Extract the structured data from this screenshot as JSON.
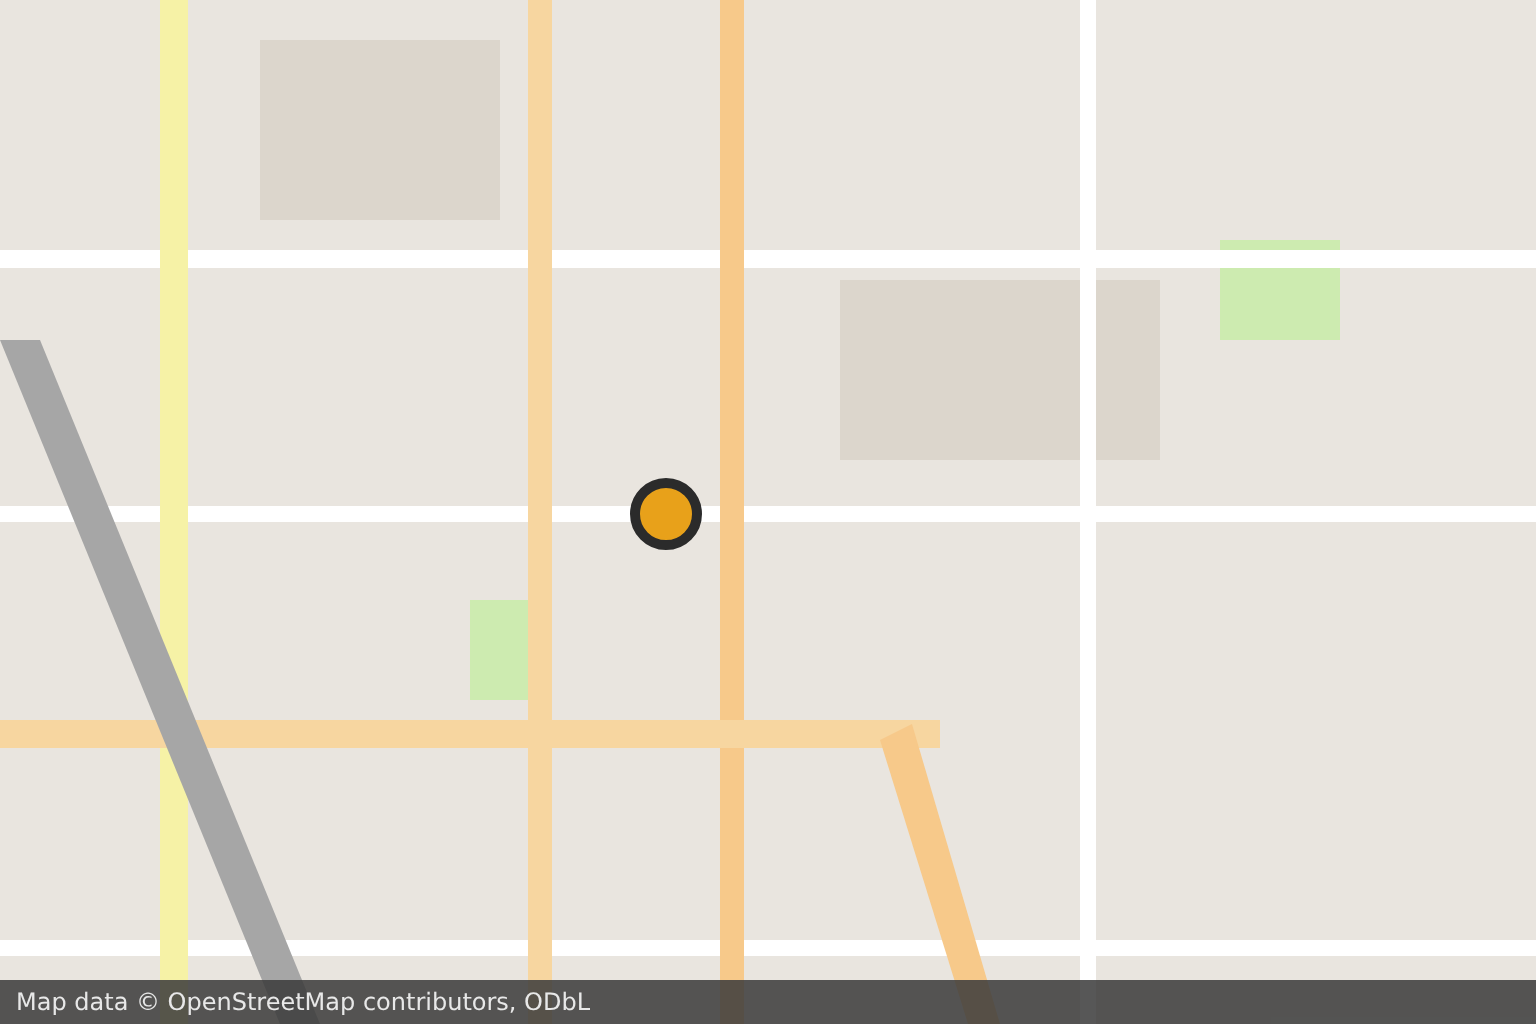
{
  "attribution": "Map data © OpenStreetMap contributors, ODbL"
}
